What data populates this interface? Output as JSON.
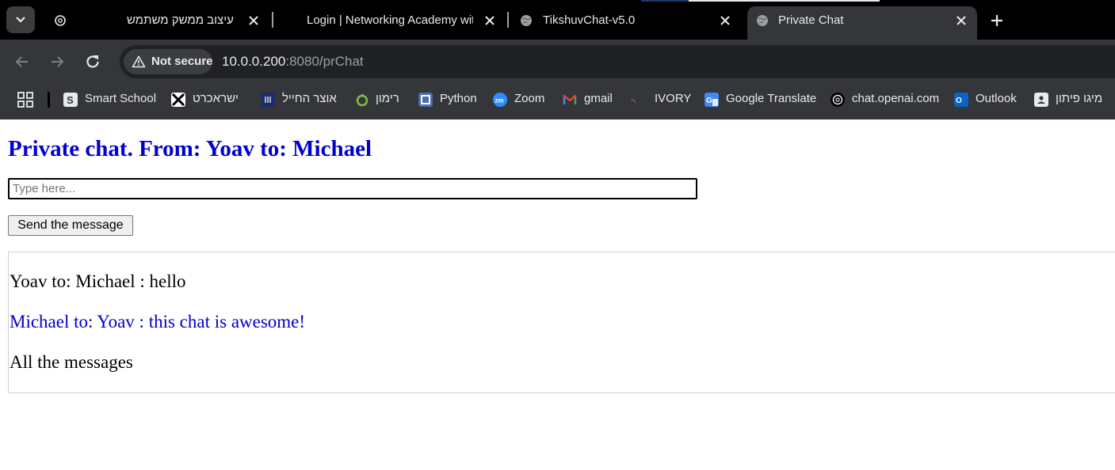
{
  "browser": {
    "tabs": [
      {
        "title": "עיצוב ממשק משתמש",
        "icon": "openai-icon"
      },
      {
        "title": "Login | Networking Academy with",
        "icon": "none"
      },
      {
        "title": "TikshuvChat-v5.0",
        "icon": "globe-icon"
      },
      {
        "title": "Private Chat",
        "icon": "globe-icon",
        "active": true
      }
    ],
    "security_label": "Not secure",
    "url_host": "10.0.0.200",
    "url_rest": ":8080/prChat",
    "bookmarks": [
      {
        "label": "Smart School",
        "icon": "smart-school-icon"
      },
      {
        "label": "ישראכרט",
        "icon": "isracard-icon"
      },
      {
        "label": "אוצר החייל",
        "icon": "otzar-hahayal-icon"
      },
      {
        "label": "רימון",
        "icon": "rimon-icon"
      },
      {
        "label": "Python",
        "icon": "python-icon"
      },
      {
        "label": "Zoom",
        "icon": "zoom-icon"
      },
      {
        "label": "gmail",
        "icon": "gmail-icon"
      },
      {
        "label": "IVORY",
        "icon": "ivory-icon"
      },
      {
        "label": "Google Translate",
        "icon": "google-translate-icon"
      },
      {
        "label": "chat.openai.com",
        "icon": "openai-icon"
      },
      {
        "label": "Outlook",
        "icon": "outlook-icon"
      },
      {
        "label": "מיגו פיתון",
        "icon": "contact-card-icon"
      }
    ],
    "colors": {
      "tabstrip": "#000000",
      "toolbar": "#35363a",
      "omnibox": "#202124"
    }
  },
  "page": {
    "title": "Private chat. From: Yoav to: Michael",
    "input_placeholder": "Type here...",
    "send_label": "Send the message",
    "messages": [
      {
        "text": "Yoav to: Michael : hello",
        "color": "#000000"
      },
      {
        "text": "Michael to: Yoav : this chat is awesome!",
        "color": "#0000cd"
      },
      {
        "text": "All the messages",
        "color": "#000000"
      }
    ]
  }
}
